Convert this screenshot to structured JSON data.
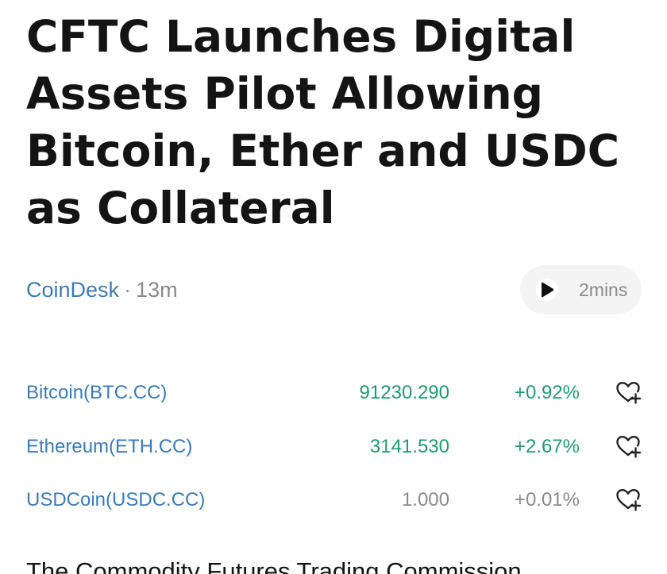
{
  "article": {
    "headline": "CFTC Launches Digital Assets Pilot Allowing Bitcoin, Ether and USDC as Collateral",
    "source": "CoinDesk",
    "separator": "·",
    "time_ago": "13m",
    "listen_label": "2mins",
    "body_start": "The Commodity Futures Trading Commission"
  },
  "tickers": [
    {
      "name": "Bitcoin(BTC.CC)",
      "price": "91230.290",
      "change": "+0.92%",
      "status": "up"
    },
    {
      "name": "Ethereum(ETH.CC)",
      "price": "3141.530",
      "change": "+2.67%",
      "status": "up"
    },
    {
      "name": "USDCoin(USDC.CC)",
      "price": "1.000",
      "change": "+0.01%",
      "status": "flat"
    }
  ],
  "icons": {
    "play": "play-icon",
    "watchlist": "heart-plus-icon"
  },
  "colors": {
    "link": "#3a7bb8",
    "up": "#1e9b6e",
    "flat": "#8a8a8a",
    "muted": "#8a8a8a"
  }
}
